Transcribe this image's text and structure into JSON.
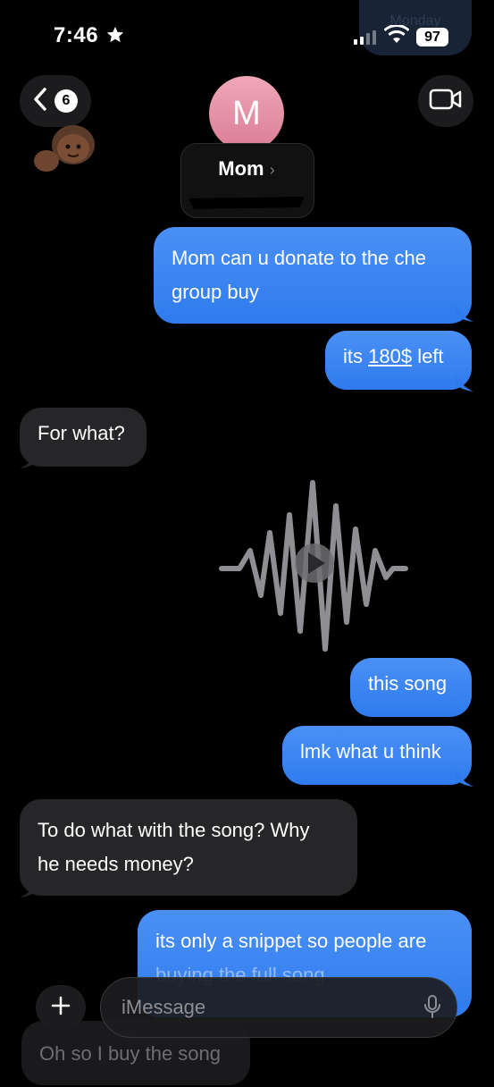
{
  "status": {
    "time": "7:46",
    "battery": "97"
  },
  "ghost_top_text": "Monday",
  "header": {
    "back_count": "6",
    "avatar_initial": "M",
    "contact_name": "Mom",
    "chevron": "›"
  },
  "messages": [
    {
      "from": "me",
      "text_lines": [
        "Mom can u donate to the che",
        "group buy"
      ]
    },
    {
      "from": "me",
      "pre": "its ",
      "link": "180$",
      "post": " left"
    },
    {
      "from": "them",
      "text": "For what?"
    },
    {
      "from": "me",
      "type": "audio",
      "icon": "play-icon"
    },
    {
      "from": "me",
      "text": "this song"
    },
    {
      "from": "me",
      "text": "lmk what u think"
    },
    {
      "from": "them",
      "text_lines": [
        "To do what with the song? Why",
        "he needs money?"
      ]
    },
    {
      "from": "me",
      "text_lines": [
        "its only a snippet so people are",
        "buying the full song"
      ]
    },
    {
      "from": "them",
      "text": "Oh so I buy the song"
    }
  ],
  "composer": {
    "placeholder": "iMessage"
  },
  "colors": {
    "sent": "#3b82f6",
    "received": "#262629",
    "background": "#000000"
  }
}
